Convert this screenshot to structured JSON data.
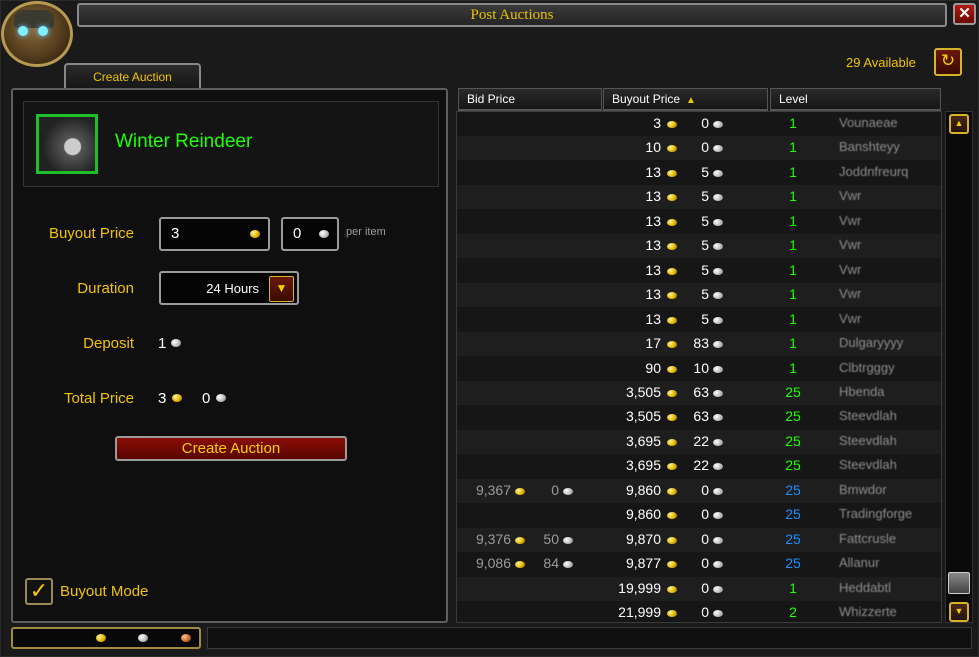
{
  "window": {
    "title": "Post Auctions",
    "close_label": "✕"
  },
  "tab": {
    "label": "Create Auction"
  },
  "item": {
    "name": "Winter Reindeer"
  },
  "form": {
    "buyout_label": "Buyout Price",
    "buyout_gold": "3",
    "buyout_silver": "0",
    "per_item": "per item",
    "duration_label": "Duration",
    "duration_value": "24 Hours",
    "deposit_label": "Deposit",
    "deposit_value": "1",
    "total_label": "Total Price",
    "total_gold": "3",
    "total_silver": "0",
    "create_button": "Create Auction",
    "buyout_mode_label": "Buyout Mode",
    "buyout_mode_checked": true
  },
  "available": "29 Available",
  "columns": {
    "bid": "Bid Price",
    "buyout": "Buyout Price",
    "level": "Level"
  },
  "level_colors": {
    "1": "#1eff00",
    "2": "#1eff00",
    "25_green": "#1eff00",
    "25_blue": "#1a8fff"
  },
  "rows": [
    {
      "bid_gold": "",
      "bid_silver": "",
      "gold": "3",
      "silver": "0",
      "level": "1",
      "lvl_color": "#1eff00",
      "seller": "Vounaeae"
    },
    {
      "bid_gold": "",
      "bid_silver": "",
      "gold": "10",
      "silver": "0",
      "level": "1",
      "lvl_color": "#1eff00",
      "seller": "Banshteyy"
    },
    {
      "bid_gold": "",
      "bid_silver": "",
      "gold": "13",
      "silver": "5",
      "level": "1",
      "lvl_color": "#1eff00",
      "seller": "Joddnfreurq"
    },
    {
      "bid_gold": "",
      "bid_silver": "",
      "gold": "13",
      "silver": "5",
      "level": "1",
      "lvl_color": "#1eff00",
      "seller": "Vwr"
    },
    {
      "bid_gold": "",
      "bid_silver": "",
      "gold": "13",
      "silver": "5",
      "level": "1",
      "lvl_color": "#1eff00",
      "seller": "Vwr"
    },
    {
      "bid_gold": "",
      "bid_silver": "",
      "gold": "13",
      "silver": "5",
      "level": "1",
      "lvl_color": "#1eff00",
      "seller": "Vwr"
    },
    {
      "bid_gold": "",
      "bid_silver": "",
      "gold": "13",
      "silver": "5",
      "level": "1",
      "lvl_color": "#1eff00",
      "seller": "Vwr"
    },
    {
      "bid_gold": "",
      "bid_silver": "",
      "gold": "13",
      "silver": "5",
      "level": "1",
      "lvl_color": "#1eff00",
      "seller": "Vwr"
    },
    {
      "bid_gold": "",
      "bid_silver": "",
      "gold": "13",
      "silver": "5",
      "level": "1",
      "lvl_color": "#1eff00",
      "seller": "Vwr"
    },
    {
      "bid_gold": "",
      "bid_silver": "",
      "gold": "17",
      "silver": "83",
      "level": "1",
      "lvl_color": "#1eff00",
      "seller": "Dulgaryyyy"
    },
    {
      "bid_gold": "",
      "bid_silver": "",
      "gold": "90",
      "silver": "10",
      "level": "1",
      "lvl_color": "#1eff00",
      "seller": "Clbtrgggy"
    },
    {
      "bid_gold": "",
      "bid_silver": "",
      "gold": "3,505",
      "silver": "63",
      "level": "25",
      "lvl_color": "#1eff00",
      "seller": "Hbenda"
    },
    {
      "bid_gold": "",
      "bid_silver": "",
      "gold": "3,505",
      "silver": "63",
      "level": "25",
      "lvl_color": "#1eff00",
      "seller": "Steevdlah"
    },
    {
      "bid_gold": "",
      "bid_silver": "",
      "gold": "3,695",
      "silver": "22",
      "level": "25",
      "lvl_color": "#1eff00",
      "seller": "Steevdlah"
    },
    {
      "bid_gold": "",
      "bid_silver": "",
      "gold": "3,695",
      "silver": "22",
      "level": "25",
      "lvl_color": "#1eff00",
      "seller": "Steevdlah"
    },
    {
      "bid_gold": "9,367",
      "bid_silver": "0",
      "gold": "9,860",
      "silver": "0",
      "level": "25",
      "lvl_color": "#1a8fff",
      "seller": "Bmwdor"
    },
    {
      "bid_gold": "",
      "bid_silver": "",
      "gold": "9,860",
      "silver": "0",
      "level": "25",
      "lvl_color": "#1a8fff",
      "seller": "Tradingforge"
    },
    {
      "bid_gold": "9,376",
      "bid_silver": "50",
      "gold": "9,870",
      "silver": "0",
      "level": "25",
      "lvl_color": "#1a8fff",
      "seller": "Fattcrusle"
    },
    {
      "bid_gold": "9,086",
      "bid_silver": "84",
      "gold": "9,877",
      "silver": "0",
      "level": "25",
      "lvl_color": "#1a8fff",
      "seller": "Allanur"
    },
    {
      "bid_gold": "",
      "bid_silver": "",
      "gold": "19,999",
      "silver": "0",
      "level": "1",
      "lvl_color": "#1eff00",
      "seller": "Heddabtl"
    },
    {
      "bid_gold": "",
      "bid_silver": "",
      "gold": "21,999",
      "silver": "0",
      "level": "2",
      "lvl_color": "#1eff00",
      "seller": "Whizzerte"
    }
  ]
}
